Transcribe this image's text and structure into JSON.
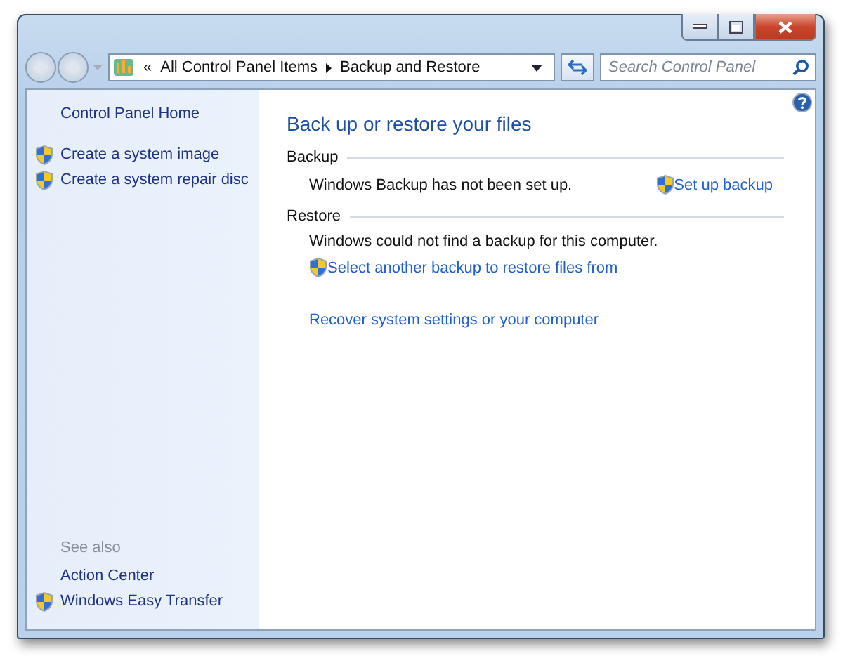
{
  "address_bar": {
    "overflow": "«",
    "crumbs": [
      "All Control Panel Items",
      "Backup and Restore"
    ]
  },
  "search": {
    "placeholder": "Search Control Panel"
  },
  "sidebar": {
    "items": [
      {
        "label": "Control Panel Home",
        "shield": false
      },
      {
        "label": "Create a system image",
        "shield": true
      },
      {
        "label": "Create a system repair disc",
        "shield": true
      }
    ],
    "see_also": {
      "heading": "See also",
      "items": [
        {
          "label": "Action Center",
          "shield": false
        },
        {
          "label": "Windows Easy Transfer",
          "shield": true
        }
      ]
    }
  },
  "main": {
    "title": "Back up or restore your files",
    "sections": [
      {
        "heading": "Backup",
        "text": "Windows Backup has not been set up.",
        "action": {
          "label": "Set up backup",
          "shield": true
        }
      },
      {
        "heading": "Restore",
        "text": "Windows could not find a backup for this computer.",
        "links": [
          {
            "label": "Select another backup to restore files from",
            "shield": true
          },
          {
            "label": "Recover system settings or your computer",
            "shield": false
          }
        ]
      }
    ]
  }
}
